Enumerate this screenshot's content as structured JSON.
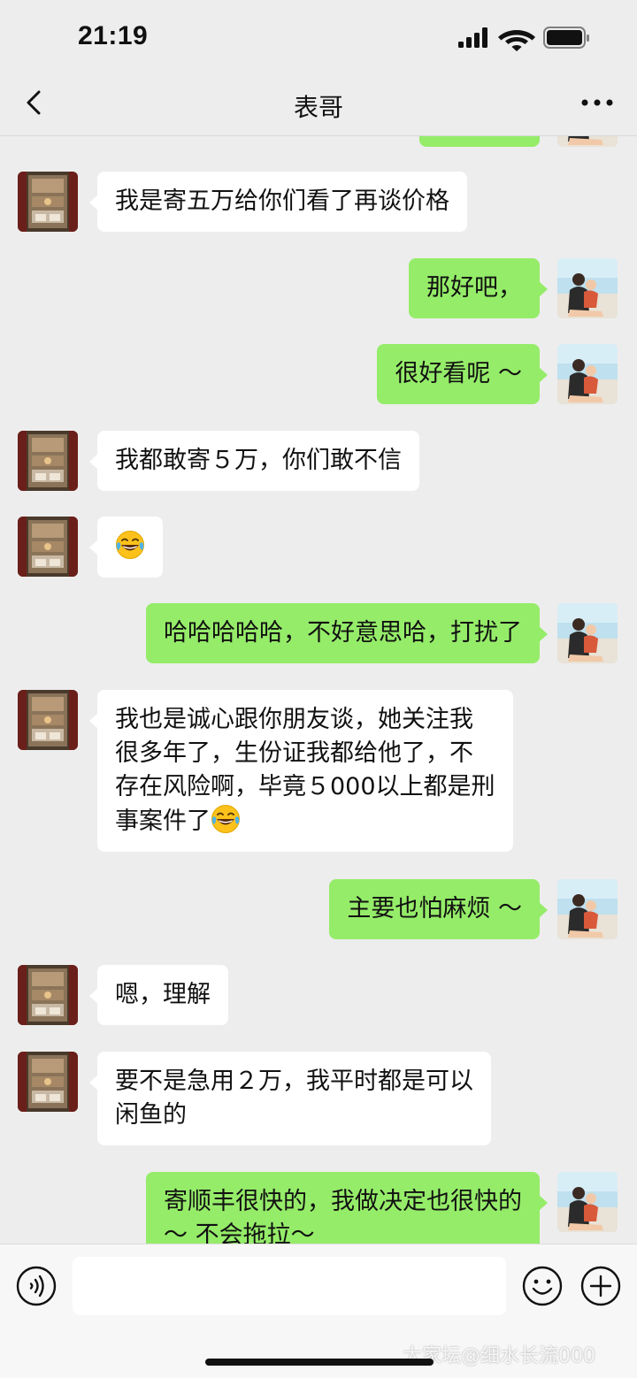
{
  "status_bar": {
    "time": "21:19"
  },
  "header": {
    "title": "表哥"
  },
  "messages": [
    {
      "side": "out",
      "text": "",
      "partial": true
    },
    {
      "side": "in",
      "text": "我是寄五万给你们看了再谈价格"
    },
    {
      "side": "out",
      "text": "那好吧，"
    },
    {
      "side": "out",
      "text": "很好看呢 ～"
    },
    {
      "side": "in",
      "text": "我都敢寄５万，你们敢不信"
    },
    {
      "side": "in",
      "text": "",
      "emoji": "tears-of-joy"
    },
    {
      "side": "out",
      "text": "哈哈哈哈哈，不好意思哈，打扰了"
    },
    {
      "side": "in",
      "lines": [
        "我也是诚心跟你朋友谈，她关注我",
        "很多年了，生份证我都给他了，不",
        "存在风险啊，毕竟５000以上都是刑",
        "事案件了"
      ],
      "emoji": "tears-of-joy"
    },
    {
      "side": "out",
      "text": "主要也怕麻烦 ～"
    },
    {
      "side": "in",
      "text": "嗯，理解"
    },
    {
      "side": "in",
      "lines": [
        "要不是急用２万，我平时都是可以",
        "闲鱼的"
      ]
    },
    {
      "side": "out",
      "lines": [
        "寄顺丰很快的，我做决定也很快的",
        "～ 不会拖拉～"
      ]
    }
  ],
  "watermark": "大家坛@细水长流000",
  "colors": {
    "background": "#ededed",
    "outgoing_bubble": "#95ec69",
    "incoming_bubble": "#ffffff"
  }
}
